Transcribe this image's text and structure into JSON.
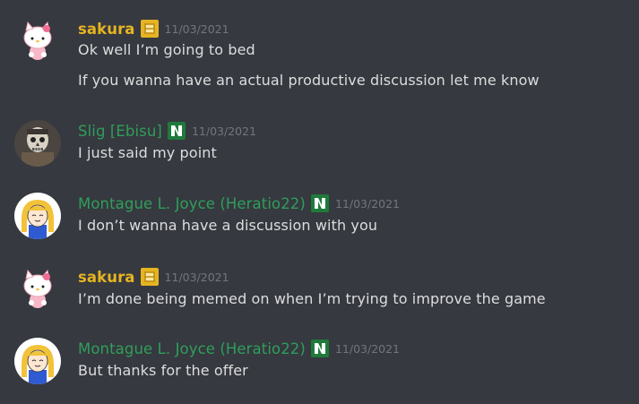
{
  "colors": {
    "background": "#36393f",
    "username_gold": "#e6b422",
    "username_green": "#2f9e5b",
    "timestamp": "#72767d",
    "message_text": "#dcddde"
  },
  "messages": [
    {
      "username": "sakura",
      "avatar_icon": "hello-kitty-avatar",
      "badge_icon": "gold-square-role-icon",
      "timestamp": "11/03/2021",
      "lines": [
        "Ok well I’m going to bed",
        "If you wanna have an actual productive discussion let me know"
      ]
    },
    {
      "username": "Slig [Ebisu]",
      "avatar_icon": "skull-mask-avatar",
      "badge_icon": "green-n-role-icon",
      "timestamp": "11/03/2021",
      "lines": [
        "I just said my point"
      ]
    },
    {
      "username": "Montague L. Joyce (Heratio22)",
      "avatar_icon": "blonde-girl-avatar",
      "badge_icon": "green-n-role-icon",
      "timestamp": "11/03/2021",
      "lines": [
        "I don’t wanna have a discussion with you"
      ]
    },
    {
      "username": "sakura",
      "avatar_icon": "hello-kitty-avatar",
      "badge_icon": "gold-square-role-icon",
      "timestamp": "11/03/2021",
      "lines": [
        "I’m done being memed on when I’m trying to improve the game"
      ]
    },
    {
      "username": "Montague L. Joyce (Heratio22)",
      "avatar_icon": "blonde-girl-avatar",
      "badge_icon": "green-n-role-icon",
      "timestamp": "11/03/2021",
      "lines": [
        "But thanks for the offer"
      ]
    }
  ]
}
